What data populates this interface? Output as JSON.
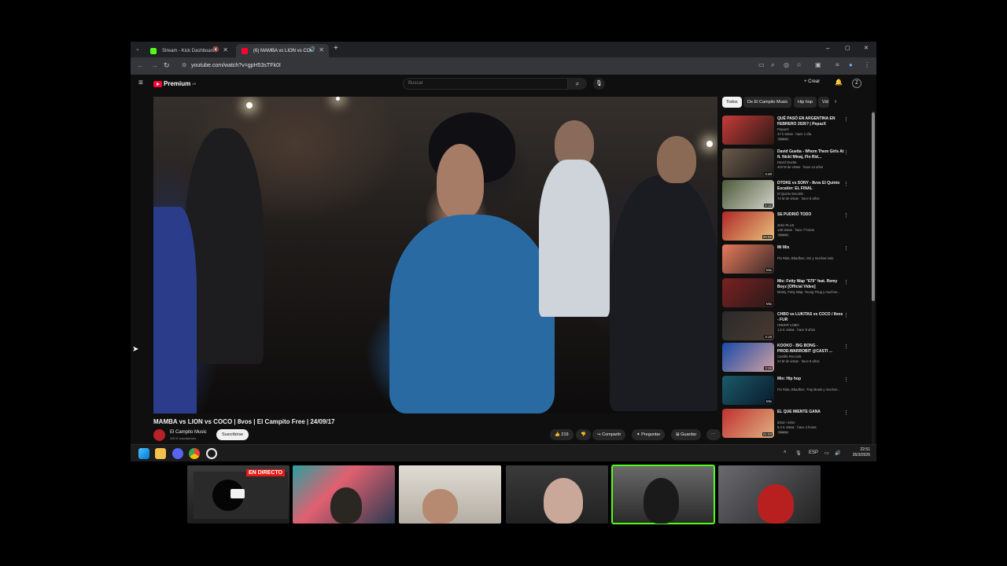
{
  "browser": {
    "tabs": [
      {
        "title": "Stream - Kick Dashboard",
        "favicon_color": "#53fc18",
        "active": false
      },
      {
        "title": "(6) MAMBA vs LION vs CO...",
        "favicon_color": "#ff0033",
        "active": true
      }
    ],
    "new_tab": "+",
    "url": "youtube.com/watch?v=gpH53sTFk0I",
    "window_controls": {
      "minimize": "–",
      "maximize": "▢",
      "close": "✕"
    }
  },
  "youtube": {
    "logo_text": "Premium",
    "logo_sup": "AR",
    "search_placeholder": "Buscar",
    "create_label": "Crear",
    "notif_count": "9+",
    "avatar_letter": "Z",
    "video": {
      "title": "MAMBA vs LION vs COCO | 8vos | El Campito Free | 24/09/17",
      "channel": "El Campito Music",
      "subscribers": "100 K suscriptores",
      "subscribe_label": "Suscribirse",
      "likes": "219",
      "share_label": "Compartir",
      "ask_label": "Preguntar",
      "save_label": "Guardar"
    },
    "chips": [
      "Todos",
      "De El Campito Music",
      "Hip hop",
      "Vid"
    ],
    "recommendations": [
      {
        "title": "QUÉ PASÓ EN ARGENTINA EN FEBRERO 2026? | PepazX",
        "channel": "PepazX",
        "meta": "37 k vistas · hace 1 día",
        "badge": "Nuevo",
        "duration": "",
        "thumb": [
          "#c63a3a",
          "#2b1a14"
        ]
      },
      {
        "title": "David Guetta - Whom Them Girls At ft. Nicki Minaj, Flo Rid...",
        "channel": "David Guetta",
        "meta": "403 M de vistas · hace 14 años",
        "badge": "",
        "duration": "3:48",
        "thumb": [
          "#6b5a4a",
          "#1c1a1a"
        ]
      },
      {
        "title": "DTOKE vs SONY - 8vos El Quinto Escalón: EL FINAL",
        "channel": "El Quinto Escalón",
        "meta": "74 M de vistas · hace 8 años",
        "badge": "",
        "duration": "5:12",
        "thumb": [
          "#4c5a3a",
          "#d3d3c8"
        ]
      },
      {
        "title": "SE PUDRIÓ TODO",
        "channel": "Zeko PLUS",
        "meta": "148 vistas · hace 7 horas",
        "badge": "Nuevo",
        "duration": "29:58",
        "thumb": [
          "#b02828",
          "#e8c07a"
        ]
      },
      {
        "title": "Mi Mix",
        "channel": "Flo Rida, Bbadboe, Ozi y muchos más",
        "meta": "",
        "badge": "",
        "duration": "Mix",
        "thumb": [
          "#e87a5a",
          "#3a2a2a"
        ]
      },
      {
        "title": "Mix: Fetty Wap \"679\" feat. Remy Boyz [Official Video]",
        "channel": "Monty, Fetty Wap, Young Thug y muchos...",
        "meta": "",
        "badge": "",
        "duration": "Mix",
        "thumb": [
          "#7a2020",
          "#2a1a1a"
        ]
      },
      {
        "title": "CHBO vs LUKITAS vs COCO / 8vos - FUR",
        "channel": "UNDER LOBO",
        "meta": "1,5 K vistas · hace 8 años",
        "badge": "",
        "duration": "3:19",
        "thumb": [
          "#2a2a2a",
          "#4a3a30"
        ]
      },
      {
        "title": "KOOKO - BIG BONG - PROD.WARROBIT @CASTI ...",
        "channel": "Castillo Records",
        "meta": "24 M de vistas · hace 8 años",
        "badge": "",
        "duration": "3:28",
        "thumb": [
          "#1a4aa8",
          "#d0a0a0"
        ]
      },
      {
        "title": "Mix: Hip hop",
        "channel": "Flo Rida, Bbadboe, Trap Beats y muchos...",
        "meta": "",
        "badge": "",
        "duration": "Mix",
        "thumb": [
          "#1a5a6a",
          "#0a1a2a"
        ]
      },
      {
        "title": "EL QUE MIENTE GANA",
        "channel": "d3n3 • Zeko",
        "meta": "5,4 K vistas · hace 4 horas",
        "badge": "Nuevo",
        "duration": "21:03",
        "thumb": [
          "#c03030",
          "#e0b080"
        ]
      }
    ]
  },
  "taskbar": {
    "lang": "ESP",
    "time": "22:51",
    "date": "26/3/2026"
  },
  "stream_overlay": {
    "live_label": "EN DIRECTO",
    "selected_index": 4
  }
}
